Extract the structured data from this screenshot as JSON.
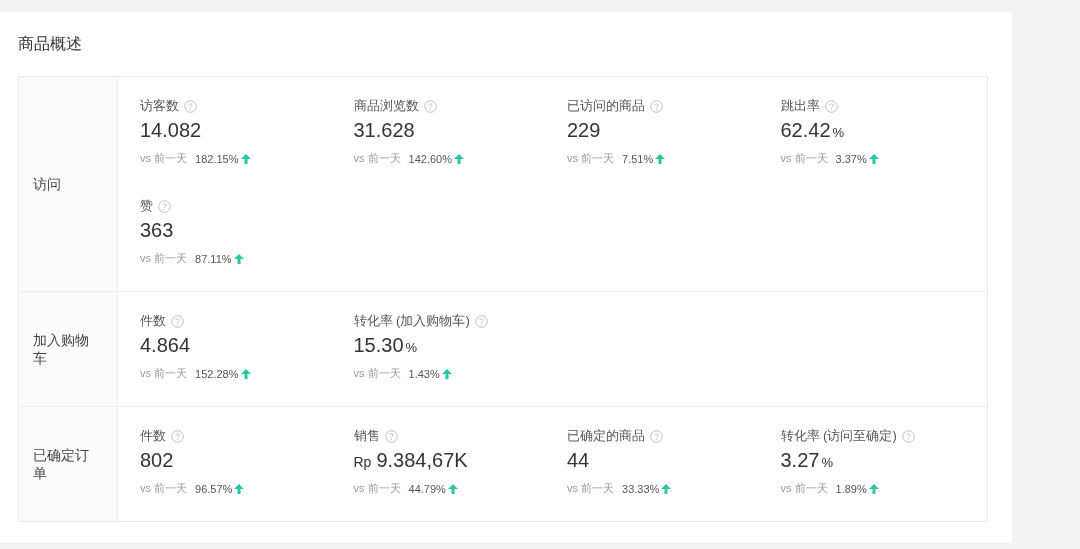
{
  "title": "商品概述",
  "sections": [
    {
      "label": "访问",
      "metrics": [
        {
          "label": "访客数",
          "value": "14.082",
          "compare": "vs 前一天",
          "change": "182.15%",
          "rising": true
        },
        {
          "label": "商品浏览数",
          "value": "31.628",
          "compare": "vs 前一天",
          "change": "142.60%",
          "rising": true
        },
        {
          "label": "已访问的商品",
          "value": "229",
          "compare": "vs 前一天",
          "change": "7.51%",
          "rising": true
        },
        {
          "label": "跳出率",
          "value": "62.42",
          "unit": "%",
          "compare": "vs 前一天",
          "change": "3.37%",
          "rising": true
        },
        {
          "label": "赞",
          "value": "363",
          "compare": "vs 前一天",
          "change": "87.11%",
          "rising": true
        }
      ]
    },
    {
      "label": "加入购物车",
      "metrics": [
        {
          "label": "件数",
          "value": "4.864",
          "compare": "vs 前一天",
          "change": "152.28%",
          "rising": true
        },
        {
          "label": "转化率 (加入购物车)",
          "value": "15.30",
          "unit": "%",
          "compare": "vs 前一天",
          "change": "1.43%",
          "rising": true
        }
      ]
    },
    {
      "label": "已确定订单",
      "metrics": [
        {
          "label": "件数",
          "value": "802",
          "compare": "vs 前一天",
          "change": "96.57%",
          "rising": true
        },
        {
          "label": "销售",
          "prefix": "Rp",
          "value": "9.384,67K",
          "compare": "vs 前一天",
          "change": "44.79%",
          "rising": true
        },
        {
          "label": "已确定的商品",
          "value": "44",
          "compare": "vs 前一天",
          "change": "33.33%",
          "rising": true
        },
        {
          "label": "转化率 (访问至确定)",
          "value": "3.27",
          "unit": "%",
          "compare": "vs 前一天",
          "change": "1.89%",
          "rising": true
        }
      ]
    }
  ]
}
